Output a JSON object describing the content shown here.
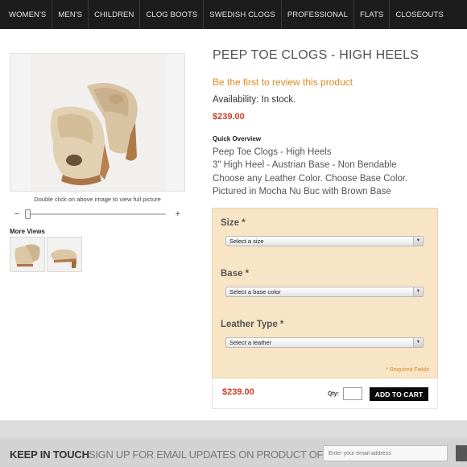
{
  "nav": {
    "items": [
      "WOMEN'S",
      "MEN'S",
      "CHILDREN",
      "CLOG BOOTS",
      "SWEDISH CLOGS",
      "PROFESSIONAL",
      "FLATS",
      "CLOSEOUTS"
    ]
  },
  "product": {
    "title": "PEEP TOE CLOGS - HIGH HEELS",
    "review_link": "Be the first to review this product",
    "availability": "Availability: In stock.",
    "price": "$239.00",
    "quick_overview_title": "Quick Overview",
    "description": [
      "Peep Toe Clogs - High Heels",
      "3\" High Heel - Austrian Base - Non Bendable",
      "Choose any Leather Color. Choose Base Color.",
      "Pictured in Mocha Nu Buc with Brown Base"
    ]
  },
  "gallery": {
    "caption": "Double click on above image to view full picture",
    "zoom_minus": "−",
    "zoom_plus": "+",
    "zoom_level": 0,
    "more_views_title": "More Views"
  },
  "options": {
    "size": {
      "label": "Size *",
      "placeholder": "Select a size"
    },
    "base": {
      "label": "Base *",
      "placeholder": "Select a base color"
    },
    "leather": {
      "label": "Leather Type *",
      "placeholder": "Select a leather"
    },
    "required_note": "* Required Fields"
  },
  "cart": {
    "price": "$239.00",
    "qty_label": "Qty:",
    "qty_value": "",
    "add_button": "ADD TO CART"
  },
  "footer": {
    "keep_in_touch": "KEEP IN TOUCH",
    "signup_text": "SIGN UP FOR EMAIL UPDATES ON PRODUCT OFFERS",
    "email_placeholder": "Enter your email address"
  },
  "colors": {
    "nav_bg": "#1c1c1c",
    "accent_orange": "#e08a1e",
    "price_red": "#c9402a",
    "options_bg": "#f8e5c5",
    "button_black": "#0a0a0a"
  },
  "icons": [
    "dropdown-arrow-icon",
    "zoom-minus-icon",
    "zoom-plus-icon"
  ]
}
